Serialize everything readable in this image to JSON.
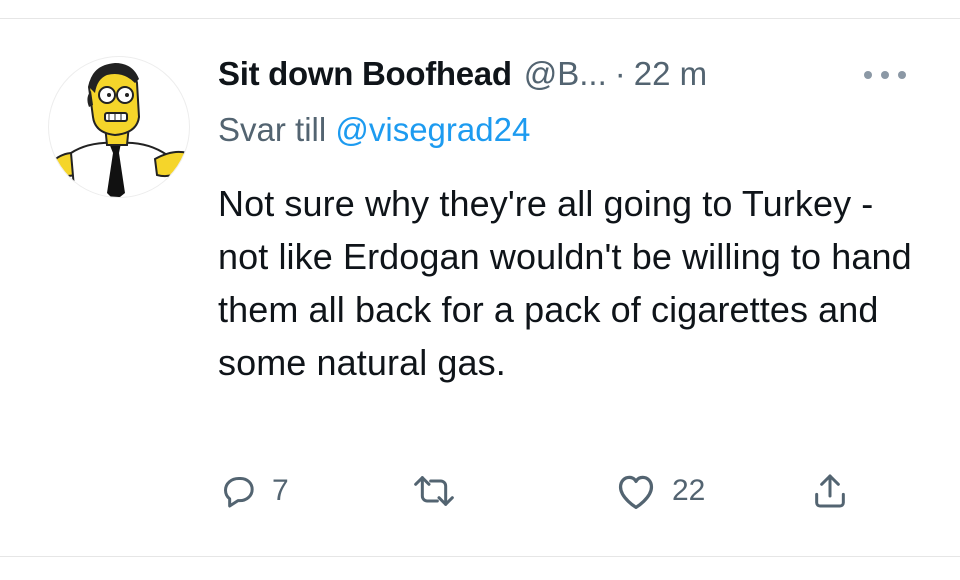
{
  "tweet": {
    "display_name": "Sit down Boofhead",
    "handle": "@B...",
    "separator": "·",
    "time": "22 m",
    "reply_prefix": "Svar till",
    "reply_to": "@visegrad24",
    "text": "Not sure why they're all going to Turkey - not like Erdogan wouldn't be willing to hand them all back for a pack of cigarettes and some natural gas."
  },
  "actions": {
    "reply_count": "7",
    "like_count": "22"
  },
  "icons": {
    "more": "more-dots-icon",
    "reply": "speech-bubble-icon",
    "retweet": "retweet-arrows-icon",
    "like": "heart-icon",
    "share": "share-upload-icon"
  },
  "colors": {
    "text_primary": "#0f1419",
    "text_secondary": "#536471",
    "link": "#1d9bf0",
    "divider": "#e6e6e6"
  }
}
